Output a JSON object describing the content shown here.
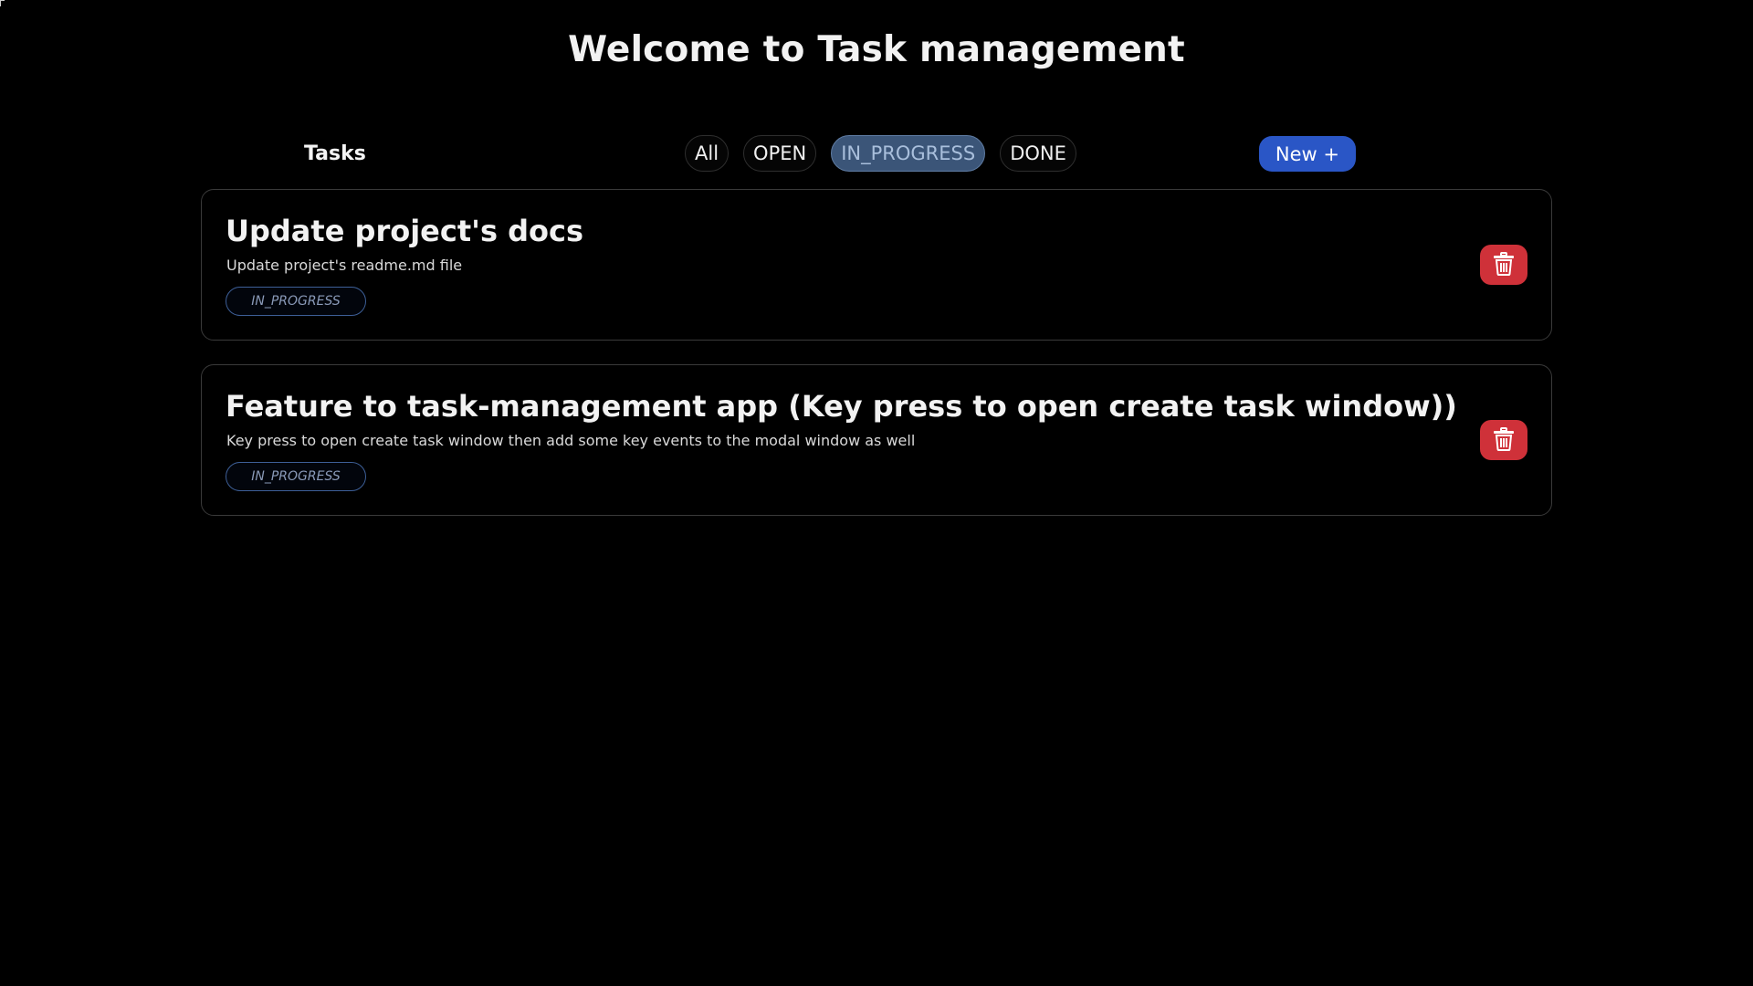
{
  "page": {
    "title": "Welcome to Task management"
  },
  "toolbar": {
    "heading": "Tasks",
    "filters": [
      {
        "label": "All",
        "active": false
      },
      {
        "label": "OPEN",
        "active": false
      },
      {
        "label": "IN_PROGRESS",
        "active": true
      },
      {
        "label": "DONE",
        "active": false
      }
    ],
    "new_label": "New +"
  },
  "tasks": [
    {
      "title": "Update project's docs",
      "description": "Update project's readme.md file",
      "status": "IN_PROGRESS"
    },
    {
      "title": "Feature to task-management app (Key press to open create task window))",
      "description": "Key press to open create task window then add some key events to the modal window as well",
      "status": "IN_PROGRESS"
    }
  ],
  "colors": {
    "background": "#000000",
    "accent": "#2a56c6",
    "active_filter": "#3b5578",
    "danger": "#cf3139",
    "badge_border": "#3d5f97"
  },
  "icons": {
    "delete": "trash-icon"
  }
}
